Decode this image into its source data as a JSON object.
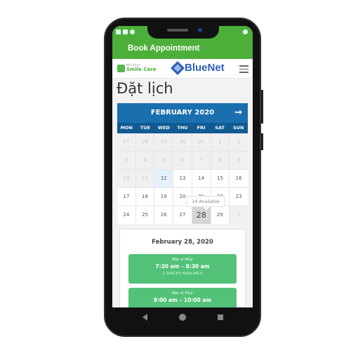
{
  "app_bar": {
    "title": "Book Appointment"
  },
  "header": {
    "logo_small": "Nha Khoa",
    "logo_brand": "Smile Care",
    "partner_logo": "BlueNet",
    "menu_icon": "hamburger-icon"
  },
  "page": {
    "title": "Đặt lịch"
  },
  "calendar": {
    "month": "FEBRUARY 2020",
    "next_icon": "arrow-right-icon",
    "weekdays": [
      "MON",
      "TUE",
      "WED",
      "THU",
      "FRI",
      "SAT",
      "SUN"
    ],
    "days": [
      {
        "d": "27",
        "s": "off"
      },
      {
        "d": "28",
        "s": "off"
      },
      {
        "d": "29",
        "s": "off"
      },
      {
        "d": "30",
        "s": "off"
      },
      {
        "d": "31",
        "s": "off"
      },
      {
        "d": "1",
        "s": "off"
      },
      {
        "d": "2",
        "s": "off"
      },
      {
        "d": "3",
        "s": "off"
      },
      {
        "d": "4",
        "s": "off"
      },
      {
        "d": "5",
        "s": "off"
      },
      {
        "d": "6",
        "s": "off"
      },
      {
        "d": "7",
        "s": "off"
      },
      {
        "d": "8",
        "s": "off"
      },
      {
        "d": "9",
        "s": "off"
      },
      {
        "d": "10",
        "s": "off"
      },
      {
        "d": "11",
        "s": "off"
      },
      {
        "d": "12",
        "s": "today"
      },
      {
        "d": "13",
        "s": ""
      },
      {
        "d": "14",
        "s": ""
      },
      {
        "d": "15",
        "s": ""
      },
      {
        "d": "16",
        "s": ""
      },
      {
        "d": "17",
        "s": ""
      },
      {
        "d": "18",
        "s": ""
      },
      {
        "d": "19",
        "s": ""
      },
      {
        "d": "20",
        "s": ""
      },
      {
        "d": "21",
        "s": ""
      },
      {
        "d": "22",
        "s": ""
      },
      {
        "d": "23",
        "s": ""
      },
      {
        "d": "24",
        "s": ""
      },
      {
        "d": "25",
        "s": ""
      },
      {
        "d": "26",
        "s": ""
      },
      {
        "d": "27",
        "s": ""
      },
      {
        "d": "28",
        "s": "sel"
      },
      {
        "d": "29",
        "s": ""
      },
      {
        "d": "1",
        "s": "off"
      }
    ],
    "tooltip": "14 Available"
  },
  "selected": {
    "date": "February 28, 2020",
    "slots": [
      {
        "doctor": "Bác sĩ HUy",
        "time": "7:30 am – 8:30 am",
        "spaces": "2 SPACES AVAILABLE"
      },
      {
        "doctor": "Bác sĩ HUy",
        "time": "9:00 am – 10:00 am",
        "spaces": ""
      }
    ]
  },
  "colors": {
    "green": "#4caf3a",
    "calendar_blue": "#1a6fae",
    "slot_green": "#52c278"
  }
}
